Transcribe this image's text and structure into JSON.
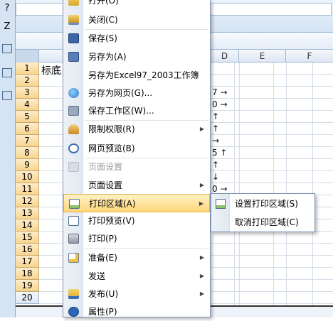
{
  "sheet": {
    "columns": [
      "D",
      "E",
      "F"
    ],
    "rows": [
      "1",
      "2",
      "3",
      "4",
      "5",
      "6",
      "7",
      "8",
      "9",
      "10",
      "11",
      "12",
      "13",
      "14",
      "15",
      "16",
      "17",
      "18",
      "19",
      "20"
    ],
    "a1_text": "标底",
    "left_glyphs": [
      "?",
      "Z"
    ],
    "d_col_fragments": [
      {
        "row": "3",
        "text": "7 →"
      },
      {
        "row": "4",
        "text": "0 →"
      },
      {
        "row": "5",
        "text": "↑"
      },
      {
        "row": "6",
        "text": "↑"
      },
      {
        "row": "7",
        "text": "→"
      },
      {
        "row": "8",
        "text": "5 ↑"
      },
      {
        "row": "9",
        "text": "↑"
      },
      {
        "row": "10",
        "text": "↓"
      },
      {
        "row": "11",
        "text": "0 →"
      },
      {
        "row": "12",
        "text": "→"
      }
    ]
  },
  "menu": {
    "items": [
      {
        "label": "打开(O)",
        "icon": "open-icon",
        "state": "normal"
      },
      {
        "label": "关闭(C)",
        "icon": "close-icon",
        "state": "normal"
      },
      {
        "label": "保存(S)",
        "icon": "save-icon",
        "state": "normal"
      },
      {
        "label": "另存为(A)",
        "icon": "save-as-icon",
        "state": "normal"
      },
      {
        "label": "另存为Excel97_2003工作簿",
        "icon": "",
        "state": "normal"
      },
      {
        "label": "另存为网页(G)...",
        "icon": "web-page-icon",
        "state": "normal"
      },
      {
        "label": "保存工作区(W)...",
        "icon": "workspace-icon",
        "state": "normal"
      },
      {
        "label": "限制权限(R)",
        "icon": "permission-icon",
        "state": "normal",
        "submenu": true
      },
      {
        "label": "网页预览(B)",
        "icon": "web-preview-icon",
        "state": "normal"
      },
      {
        "label": "页面设置",
        "icon": "page-setup-icon",
        "state": "disabled"
      },
      {
        "label": "页面设置",
        "icon": "",
        "state": "normal",
        "submenu": true
      },
      {
        "label": "打印区域(A)",
        "icon": "print-area-icon",
        "state": "active",
        "submenu": true
      },
      {
        "label": "打印预览(V)",
        "icon": "print-preview-icon",
        "state": "normal"
      },
      {
        "label": "打印(P)",
        "icon": "print-icon",
        "state": "normal"
      },
      {
        "label": "准备(E)",
        "icon": "prepare-icon",
        "state": "normal",
        "submenu": true
      },
      {
        "label": "发送",
        "icon": "",
        "state": "normal",
        "submenu": true
      },
      {
        "label": "发布(U)",
        "icon": "publish-icon",
        "state": "normal",
        "submenu": true
      },
      {
        "label": "属性(P)",
        "icon": "properties-icon",
        "state": "normal"
      }
    ]
  },
  "submenu": {
    "items": [
      {
        "label": "设置打印区域(S)",
        "icon": "set-print-area-icon"
      },
      {
        "label": "取消打印区域(C)",
        "icon": ""
      }
    ]
  },
  "colors": {
    "active_highlight": "#ffd77a",
    "row_header_selected": "#f7d58f",
    "menu_border": "#7d94b6"
  }
}
